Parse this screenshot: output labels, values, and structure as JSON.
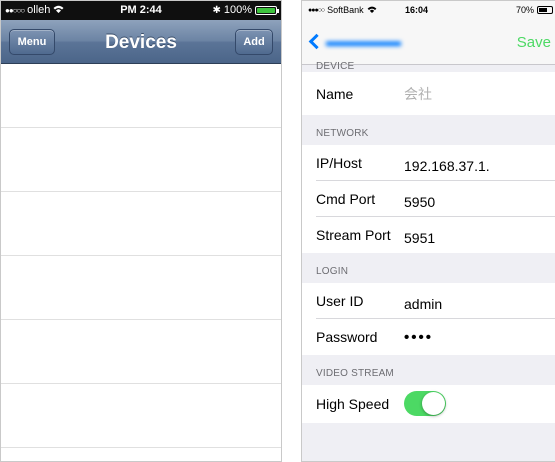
{
  "left_screen": {
    "status_bar": {
      "carrier": "olleh",
      "time": "PM 2:44",
      "battery": "100%"
    },
    "nav": {
      "title": "Devices",
      "menu_label": "Menu",
      "add_label": "Add"
    },
    "list_rows": 6
  },
  "right_screen": {
    "status_bar": {
      "carrier": "SoftBank",
      "time": "16:04",
      "battery": "70%"
    },
    "nav": {
      "save_label": "Save"
    },
    "sections": {
      "device": {
        "header": "DEVICE",
        "name_label": "Name",
        "name_value": "会社"
      },
      "network": {
        "header": "NETWORK",
        "host_label": "IP/Host",
        "host_value": "192.168.37.1.",
        "cmd_label": "Cmd Port",
        "cmd_value": "5950",
        "stream_label": "Stream Port",
        "stream_value": "5951"
      },
      "login": {
        "header": "LOGIN",
        "user_label": "User ID",
        "user_value": "admin",
        "password_label": "Password",
        "password_value": "••••"
      },
      "video": {
        "header": "VIDEO STREAM",
        "speed_label": "High Speed",
        "speed_on": true
      }
    }
  },
  "colors": {
    "ios6_nav": "#6c84a4",
    "ios7_tint": "#007aff",
    "save_green": "#4cd964",
    "toggle_on": "#4cd964"
  }
}
